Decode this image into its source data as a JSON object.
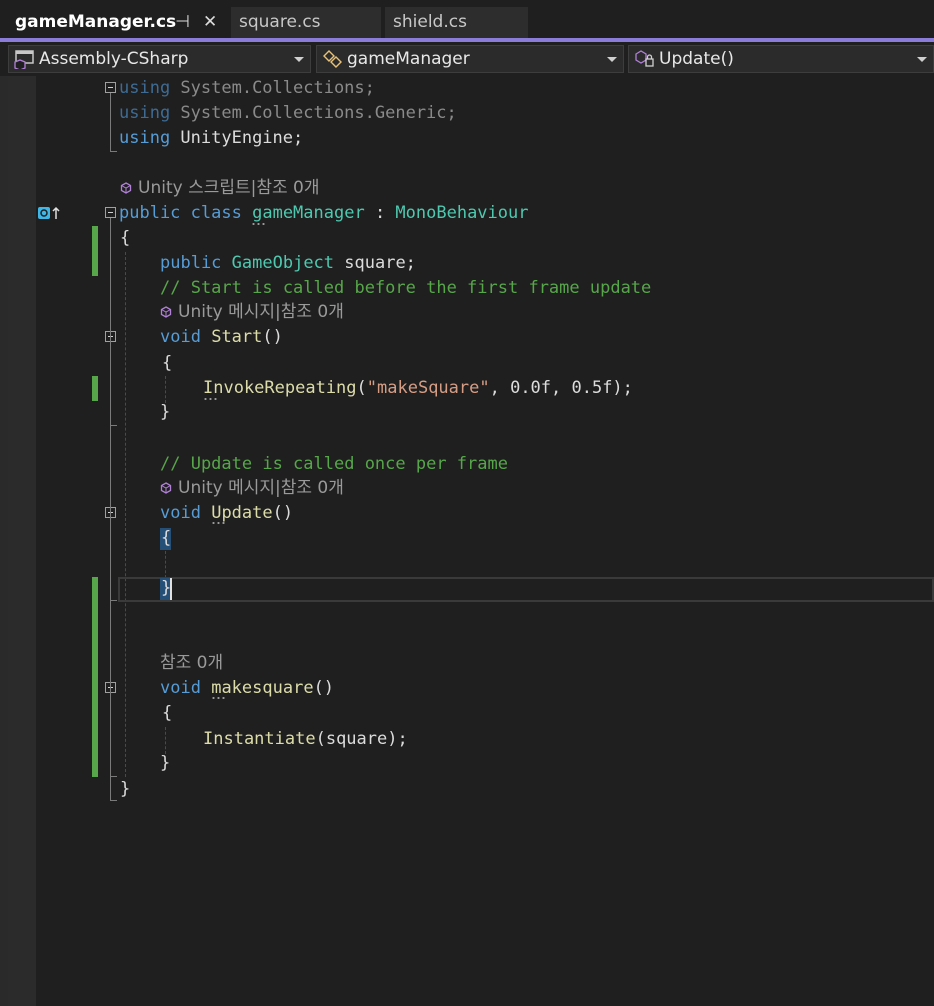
{
  "tabs": [
    {
      "label": "gameManager.cs",
      "active": true,
      "pinned": true
    },
    {
      "label": "square.cs",
      "active": false
    },
    {
      "label": "shield.cs",
      "active": false
    }
  ],
  "navbar": {
    "project": "Assembly-CSharp",
    "class": "gameManager",
    "member": "Update()"
  },
  "hints": {
    "unity_script": "Unity 스크립트|참조 0개",
    "unity_message": "Unity 메시지|참조 0개",
    "refs_zero": "참조 0개"
  },
  "code": {
    "kw_using": "using",
    "ns_collections": " System.Collections;",
    "ns_generic": " System.Collections.Generic;",
    "ns_unity": " UnityEngine;",
    "kw_public": "public",
    "kw_class": "class",
    "class_name": "gameManager",
    "colon": " : ",
    "base_class": "MonoBehaviour",
    "open_brace": "{",
    "close_brace": "}",
    "type_gameobject": "GameObject",
    "field_name": " square;",
    "comment_start": "// Start is called before the first frame update",
    "kw_void": "void",
    "fn_start": "Start",
    "parens": "()",
    "fn_invoke": "InvokeRepeating",
    "invoke_open": "(",
    "invoke_str": "\"makeSquare\"",
    "invoke_args": ", 0.0f, 0.5f);",
    "comment_update": "// Update is called once per frame",
    "fn_update": "Update",
    "fn_makesquare": "makesquare",
    "fn_instantiate": "Instantiate",
    "instantiate_args": "(square);"
  },
  "colors": {
    "keyword": "#569cd6",
    "type": "#4ec9b0",
    "method": "#dcdcaa",
    "string": "#d69d85",
    "comment": "#57a64a",
    "tab_accent": "#8a7cd8",
    "change_bar": "#57a64a"
  }
}
